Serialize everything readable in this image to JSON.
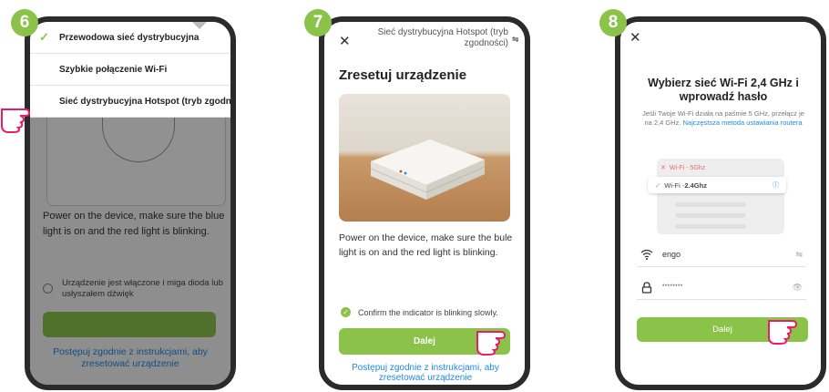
{
  "steps": {
    "six": {
      "badge": "6",
      "menu": [
        {
          "label": "Przewodowa sieć dystrybucyjna",
          "checked": true
        },
        {
          "label": "Szybkie połączenie Wi-Fi",
          "checked": false
        },
        {
          "label": "Sieć dystrybucyjna Hotspot (tryb zgodności)",
          "checked": false
        }
      ],
      "instruction": "Power on the device, make sure the blue light is on and the red light is blinking.",
      "checkbox_label": "Urządzenie jest włączone i miga dioda lub usłyszałem dźwięk",
      "link": "Postępuj zgodnie z instrukcjami, aby zresetować urządzenie"
    },
    "seven": {
      "badge": "7",
      "close_icon": "✕",
      "header": "Sieć dystrybucyjna Hotspot (tryb zgodności)",
      "switch_icon": "⇋",
      "title": "Zresetuj urządzenie",
      "instruction": "Power on the device, make sure the bule light is on and the red light is blinking.",
      "confirm": "Confirm the indicator is blinking slowly.",
      "button": "Dalej",
      "link": "Postępuj zgodnie z instrukcjami, aby zresetować urządzenie"
    },
    "eight": {
      "badge": "8",
      "close_icon": "✕",
      "title": "Wybierz sieć Wi-Fi 2,4 GHz i wprowadź hasło",
      "desc": "Jeśli Twoje Wi-Fi działa na paśmie 5 GHz, przełącz je na 2,4 GHz.",
      "desc_link": "Najczęstsza metoda ustawiania routera",
      "bad_net": "Wi-Fi - 5Ghz",
      "good_net_prefix": "Wi-Fi - ",
      "good_net": "2.4Ghz",
      "ssid": "engo",
      "password": "********",
      "button": "Dalej"
    }
  },
  "colors": {
    "accent": "#8bc34a",
    "link": "#1e88e5",
    "frame": "#2b2b2b"
  }
}
